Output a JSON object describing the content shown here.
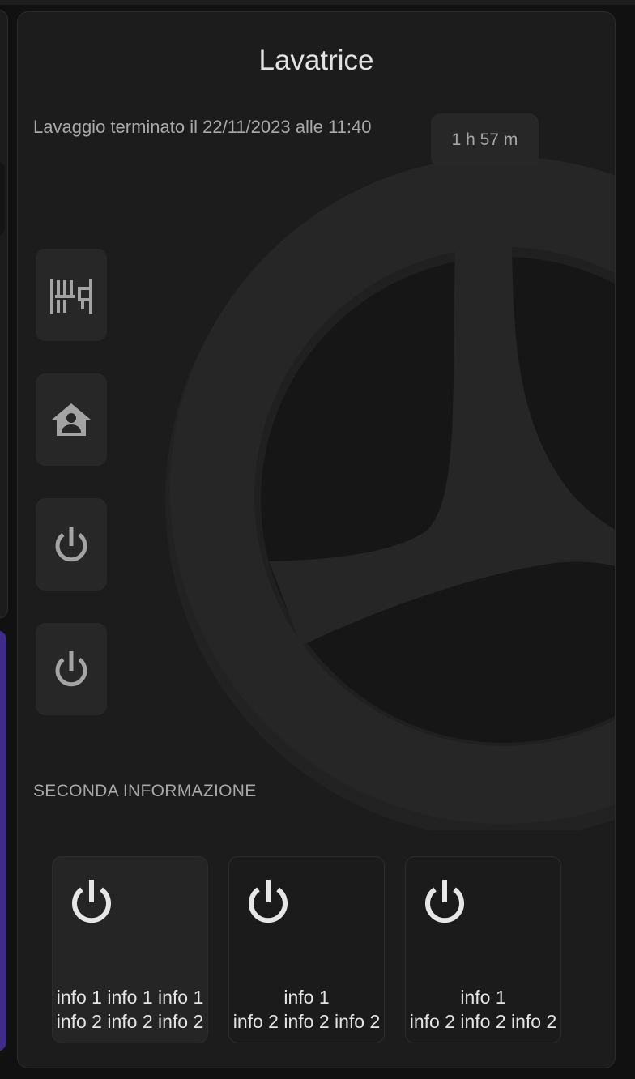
{
  "card": {
    "title": "Lavatrice",
    "status": "Lavaggio terminato il 22/11/2023 alle 11:40",
    "time_remaining": "1 h 57 m",
    "section_label": "SECONDA INFORMAZIONE"
  },
  "side_buttons": [
    {
      "icon": "washing-program-icon"
    },
    {
      "icon": "home-account-icon"
    },
    {
      "icon": "power-icon"
    },
    {
      "icon": "power-icon"
    }
  ],
  "tiles": [
    {
      "icon": "power-icon",
      "line1": "info 1 info 1 info 1",
      "line2": "info 2 info 2 info 2"
    },
    {
      "icon": "power-icon",
      "line1": "info 1",
      "line2": "info 2 info 2 info 2"
    },
    {
      "icon": "power-icon",
      "line1": "info 1",
      "line2": "info 2 info 2 info 2"
    }
  ],
  "colors": {
    "card_background": "#1c1c1c",
    "button_background": "#272727",
    "icon_color": "#a4a4a4",
    "tile_icon_color": "#e6e6e6",
    "wheel_color": "#262626",
    "left_card_accent": "#3f2c86"
  }
}
